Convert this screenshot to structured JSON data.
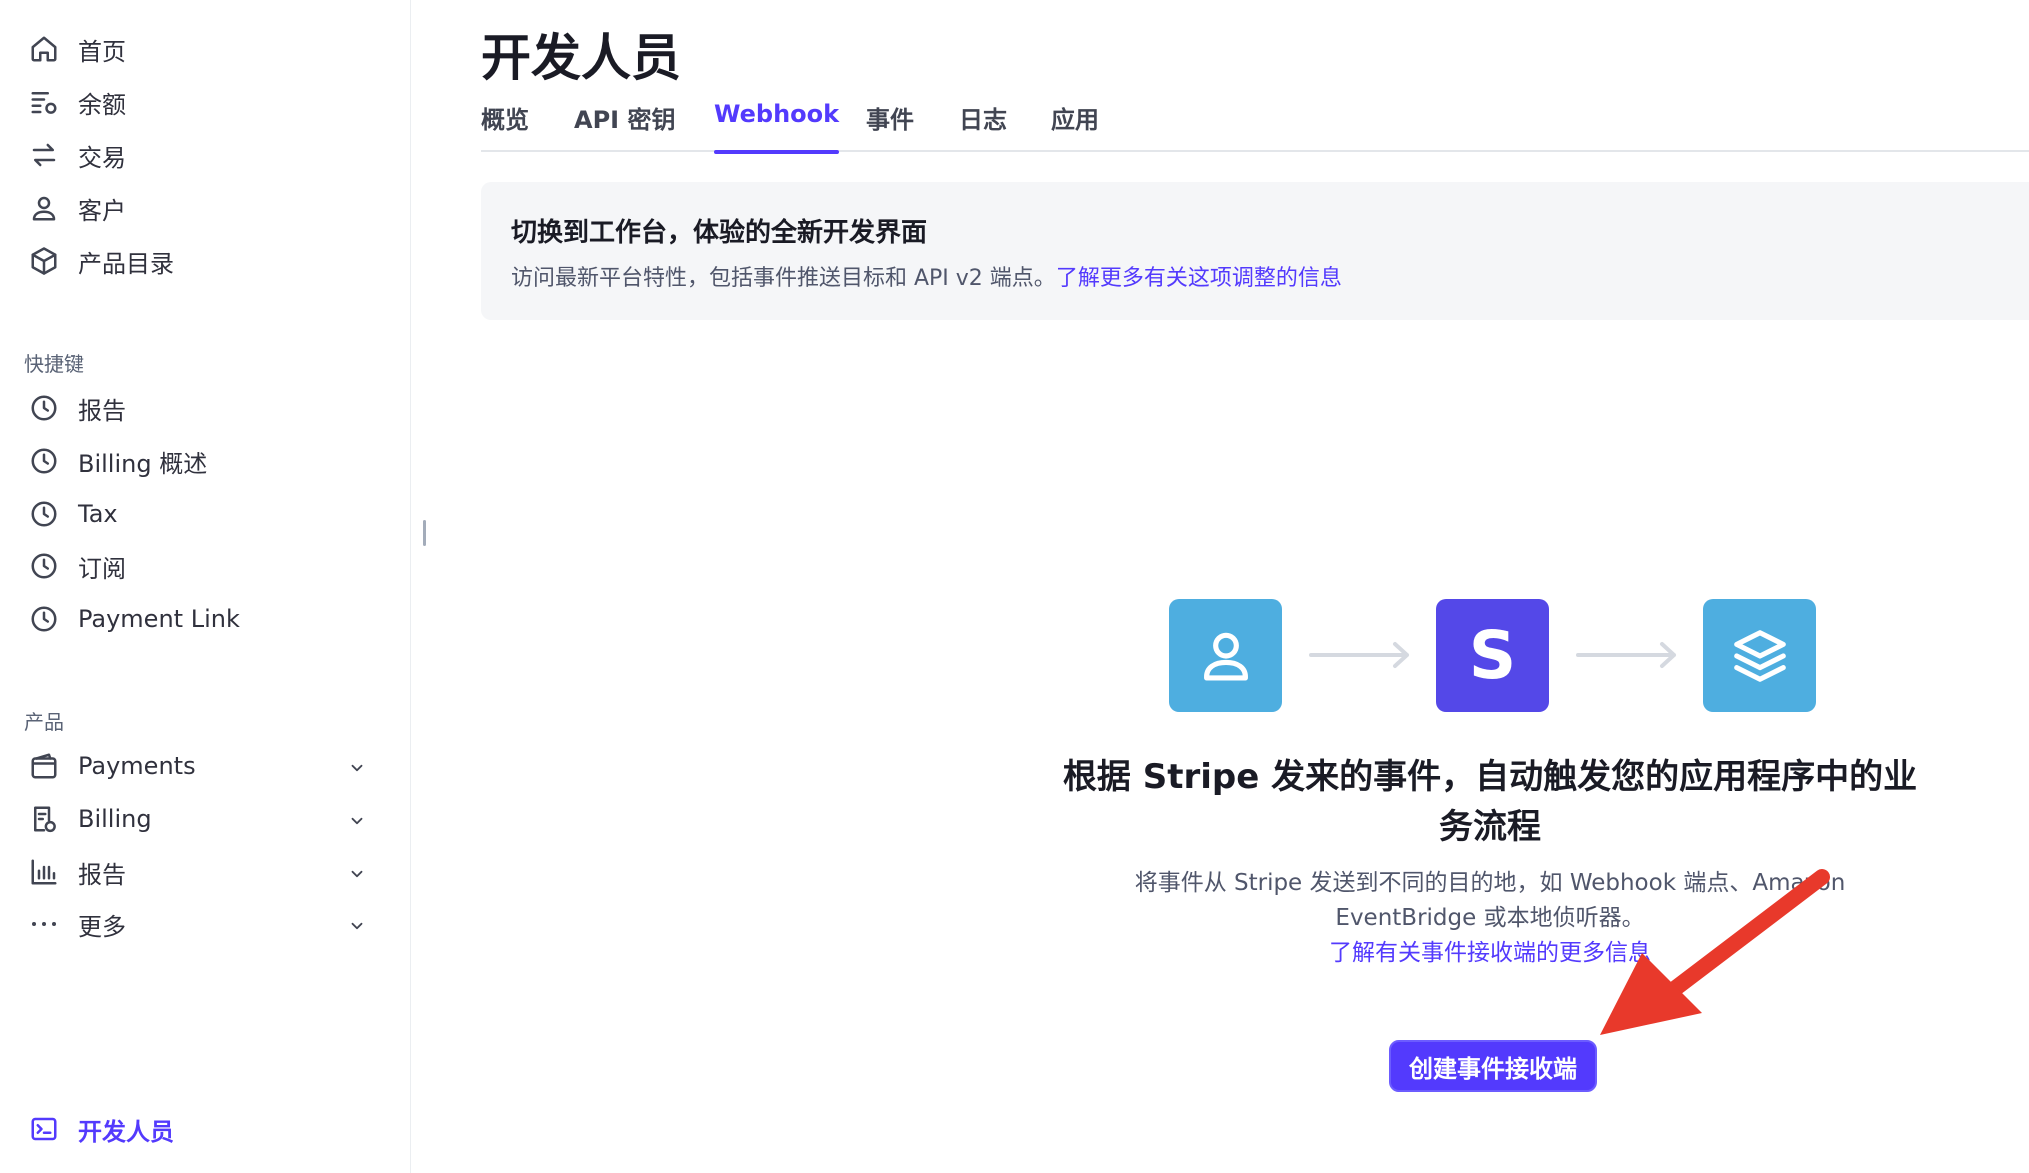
{
  "sidebar": {
    "main_items": [
      {
        "label": "首页",
        "icon": "home-icon"
      },
      {
        "label": "余额",
        "icon": "balance-icon"
      },
      {
        "label": "交易",
        "icon": "transactions-icon"
      },
      {
        "label": "客户",
        "icon": "customer-icon"
      },
      {
        "label": "产品目录",
        "icon": "product-catalog-icon"
      }
    ],
    "shortcuts_title": "快捷键",
    "shortcuts": [
      {
        "label": "报告",
        "icon": "clock-icon"
      },
      {
        "label": "Billing 概述",
        "icon": "clock-icon"
      },
      {
        "label": "Tax",
        "icon": "clock-icon"
      },
      {
        "label": "订阅",
        "icon": "clock-icon"
      },
      {
        "label": "Payment Link",
        "icon": "clock-icon"
      }
    ],
    "products_title": "产品",
    "products": [
      {
        "label": "Payments",
        "icon": "wallet-icon"
      },
      {
        "label": "Billing",
        "icon": "billing-icon"
      },
      {
        "label": "报告",
        "icon": "bar-chart-icon"
      },
      {
        "label": "更多",
        "icon": "more-icon"
      }
    ],
    "developer": {
      "label": "开发人员",
      "icon": "terminal-icon"
    }
  },
  "main": {
    "title": "开发人员",
    "tabs": [
      {
        "label": "概览"
      },
      {
        "label": "API 密钥"
      },
      {
        "label": "Webhook"
      },
      {
        "label": "事件"
      },
      {
        "label": "日志"
      },
      {
        "label": "应用"
      }
    ],
    "active_tab": "Webhook",
    "banner": {
      "title": "切换到工作台，体验的全新开发界面",
      "text": "访问最新平台特性，包括事件推送目标和 API v2 端点。",
      "link": "了解更多有关这项调整的信息"
    },
    "hero": {
      "title": "根据 Stripe 发来的事件，自动触发您的应用程序中的业务流程",
      "description": "将事件从 Stripe 发送到不同的目的地，如 Webhook 端点、Amazon EventBridge 或本地侦听器。",
      "link": "了解有关事件接收端的更多信息",
      "stripe_letter": "S"
    },
    "cta_label": "创建事件接收端"
  },
  "colors": {
    "accent": "#533afd",
    "tile_blue": "#4eaee0",
    "tile_purple": "#5448e8",
    "annotation_red": "#e8392b"
  }
}
